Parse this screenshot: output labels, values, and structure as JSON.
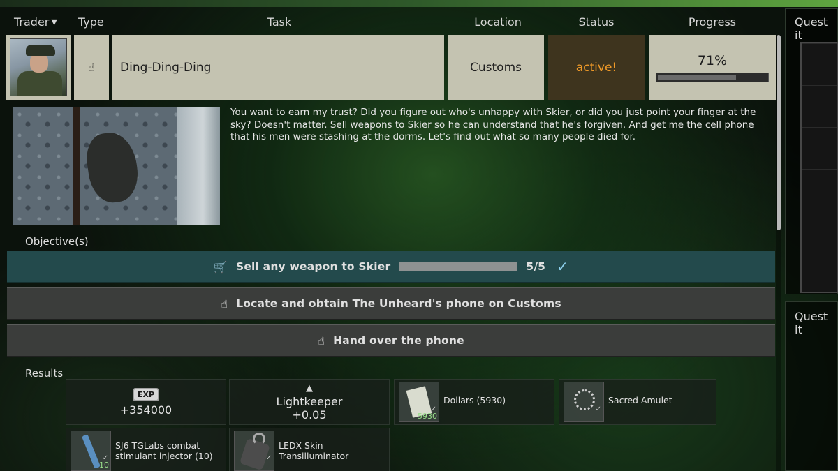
{
  "colors": {
    "status_active": "#f09a28",
    "objective_done_bg": "#234a4c",
    "objective_todo_bg": "#3b3d3b",
    "task_row_bg": "#c4c3b1",
    "check": "#8fd2f0"
  },
  "header": {
    "trader": "Trader",
    "type": "Type",
    "task": "Task",
    "location": "Location",
    "status": "Status",
    "progress": "Progress"
  },
  "quest": {
    "trader_icon": "trader-portrait",
    "type_icon": "hand-pointer-icon",
    "name": "Ding-Ding-Ding",
    "location": "Customs",
    "status": "active!",
    "progress_text": "71%",
    "progress_fraction": 0.71,
    "description": "You want to earn my trust? Did you figure out who's unhappy with Skier, or did you just point your finger at the sky? Doesn't matter. Sell weapons to Skier so he can understand that he's forgiven. And get me the cell phone that his men were stashing at the dorms. Let's find out what so many people died for."
  },
  "objectives_label": "Objective(s)",
  "objectives": [
    {
      "icon": "cart-icon",
      "text": "Sell any weapon to Skier",
      "count": "5/5",
      "complete": true
    },
    {
      "icon": "hand-pointer-icon",
      "text": "Locate and obtain The Unheard's phone on Customs",
      "complete": false
    },
    {
      "icon": "hand-pointer-icon",
      "text": "Hand over the phone",
      "complete": false
    }
  ],
  "results_label": "Results",
  "rewards": {
    "exp": {
      "badge": "EXP",
      "value": "+354000"
    },
    "rep": {
      "icon": "reputation-icon",
      "name": "Lightkeeper",
      "value": "+0.05"
    },
    "dollars": {
      "name": "Dollars (5930)",
      "qty": "5930"
    },
    "amulet": {
      "name": "Sacred Amulet"
    },
    "sj6": {
      "name_line1": "SJ6 TGLabs combat",
      "name_line2": "stimulant injector (10)",
      "qty": "10"
    },
    "ledx": {
      "name_line1": "LEDX Skin",
      "name_line2": "Transilluminator"
    }
  },
  "right_panel": {
    "title1": "Quest it",
    "title2": "Quest it"
  }
}
